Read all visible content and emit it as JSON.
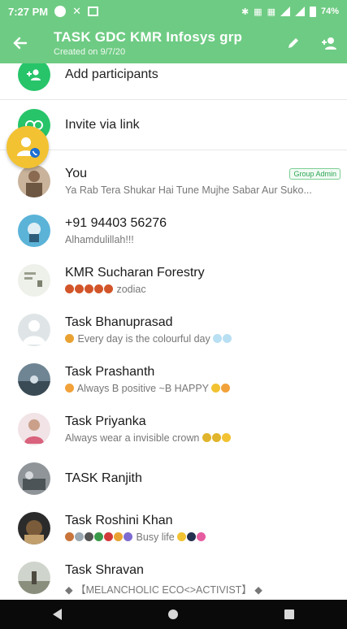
{
  "status_bar": {
    "time": "7:27 PM",
    "battery": "74%"
  },
  "header": {
    "title": "TASK GDC KMR Infosys grp",
    "subtitle": "Created on 9/7/20"
  },
  "actions": {
    "add_participants": "Add participants",
    "invite_via_link": "Invite via link"
  },
  "members": [
    {
      "name": "You",
      "about": "Ya Rab Tera Shukar Hai Tune Mujhe Sabar Aur Suko...",
      "badge": "Group Admin"
    },
    {
      "name": "+91 94403 56276",
      "about": "Alhamdulillah!!!"
    },
    {
      "name": "KMR Sucharan Forestry",
      "about": "zodiac"
    },
    {
      "name": "Task Bhanuprasad",
      "about": "Every day is the colourful day"
    },
    {
      "name": "Task Prashanth",
      "about": "Always B positive ~B HAPPY"
    },
    {
      "name": "Task Priyanka",
      "about": "Always wear a invisible crown"
    },
    {
      "name": "TASK Ranjith",
      "about": ""
    },
    {
      "name": "Task Roshini Khan",
      "about": "Busy life"
    },
    {
      "name": "Task Shravan",
      "about": "◆ 【MELANCHOLIC ECO<>ACTIVIST】 ◆"
    }
  ],
  "colors": {
    "header": "#6ecb83",
    "accent": "#27c46a",
    "nav": "#0a0a0a"
  }
}
